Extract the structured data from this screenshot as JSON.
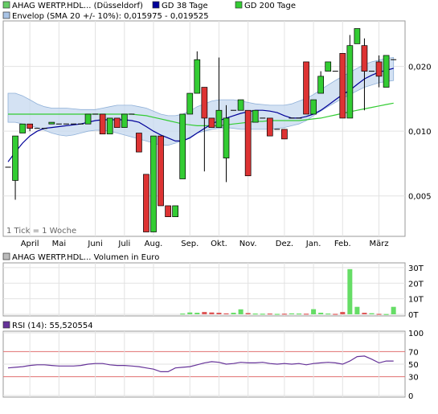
{
  "main_panel": {
    "legend": [
      {
        "label": "AHAG WERTP.HDL... (Düsseldorf)",
        "color": "#66cc66"
      },
      {
        "label": "GD 38 Tage",
        "color": "#000099"
      },
      {
        "label": "GD 200 Tage",
        "color": "#33cc33"
      },
      {
        "label": "Envelop (SMA 20 +/- 10%): 0,015975 - 0,019525",
        "color": "#a9c4e6"
      }
    ],
    "note": "1 Tick = 1 Woche",
    "y_ticks": [
      {
        "v": 0.005,
        "label": "0,005"
      },
      {
        "v": 0.01,
        "label": "0,010"
      },
      {
        "v": 0.02,
        "label": "0,020"
      }
    ],
    "months": [
      {
        "i": 3,
        "label": "April"
      },
      {
        "i": 7,
        "label": "Mai"
      },
      {
        "i": 12,
        "label": "Juni"
      },
      {
        "i": 16,
        "label": "Juli"
      },
      {
        "i": 20,
        "label": "Aug."
      },
      {
        "i": 25,
        "label": "Sep."
      },
      {
        "i": 29,
        "label": "Okt."
      },
      {
        "i": 33,
        "label": "Nov."
      },
      {
        "i": 38,
        "label": "Dez."
      },
      {
        "i": 42,
        "label": "Jan."
      },
      {
        "i": 46,
        "label": "Feb."
      },
      {
        "i": 51,
        "label": "März"
      }
    ]
  },
  "volume_panel": {
    "legend": {
      "label": "AHAG WERTP.HDL... Volumen in Euro",
      "color": "#bbbbbb"
    },
    "y_ticks": [
      {
        "v": 0,
        "label": "0T"
      },
      {
        "v": 10,
        "label": "10T"
      },
      {
        "v": 20,
        "label": "20T"
      },
      {
        "v": 30,
        "label": "30T"
      }
    ]
  },
  "rsi_panel": {
    "legend": {
      "label": "RSI (14): 55,520554",
      "color": "#663399"
    },
    "y_ticks": [
      {
        "v": 0,
        "label": "0"
      },
      {
        "v": 30,
        "label": "30"
      },
      {
        "v": 50,
        "label": "50"
      },
      {
        "v": 70,
        "label": "70"
      },
      {
        "v": 100,
        "label": "100"
      }
    ],
    "ref_lines": [
      30,
      70
    ]
  },
  "chart_data": [
    {
      "type": "candlestick",
      "scale": "log",
      "ylim": [
        0.0033,
        0.032
      ],
      "legend_placement": "top-left",
      "x": "weekly ticks, Mar–Mar (54 weeks)",
      "candles": [
        [
          0.0068,
          0.0068,
          0.0068,
          0.0068
        ],
        [
          0.0059,
          0.0095,
          0.0048,
          0.0095
        ],
        [
          0.0098,
          0.0108,
          0.0098,
          0.0108
        ],
        [
          0.0108,
          0.0108,
          0.01,
          0.0103
        ],
        [
          0.0103,
          0.0103,
          0.0103,
          0.0103
        ],
        [
          0.0103,
          0.0103,
          0.0103,
          0.0103
        ],
        [
          0.0108,
          0.011,
          0.0108,
          0.011
        ],
        [
          0.0108,
          0.0108,
          0.0108,
          0.0108
        ],
        [
          0.0108,
          0.0108,
          0.0108,
          0.0108
        ],
        [
          0.0108,
          0.0108,
          0.0108,
          0.0108
        ],
        [
          0.0108,
          0.0108,
          0.0108,
          0.0108
        ],
        [
          0.0108,
          0.012,
          0.0108,
          0.012
        ],
        [
          0.012,
          0.012,
          0.012,
          0.012
        ],
        [
          0.012,
          0.012,
          0.0097,
          0.0097
        ],
        [
          0.0097,
          0.0115,
          0.0097,
          0.0115
        ],
        [
          0.0115,
          0.0115,
          0.0104,
          0.0104
        ],
        [
          0.0104,
          0.012,
          0.0104,
          0.012
        ],
        [
          0.012,
          0.012,
          0.012,
          0.012
        ],
        [
          0.0098,
          0.0098,
          0.008,
          0.008
        ],
        [
          0.0063,
          0.0063,
          0.0034,
          0.0034
        ],
        [
          0.0034,
          0.0095,
          0.0034,
          0.0095
        ],
        [
          0.0095,
          0.0095,
          0.0045,
          0.0045
        ],
        [
          0.0045,
          0.0045,
          0.004,
          0.004
        ],
        [
          0.004,
          0.0045,
          0.004,
          0.0045
        ],
        [
          0.006,
          0.012,
          0.006,
          0.012
        ],
        [
          0.012,
          0.015,
          0.012,
          0.015
        ],
        [
          0.015,
          0.0235,
          0.015,
          0.0215
        ],
        [
          0.016,
          0.016,
          0.0065,
          0.0115
        ],
        [
          0.0115,
          0.0115,
          0.0104,
          0.0104
        ],
        [
          0.0104,
          0.022,
          0.0104,
          0.0125
        ],
        [
          0.0075,
          0.0132,
          0.0058,
          0.0115
        ],
        [
          0.0125,
          0.0125,
          0.0125,
          0.0125
        ],
        [
          0.0125,
          0.014,
          0.0125,
          0.014
        ],
        [
          0.0125,
          0.0125,
          0.0062,
          0.0062
        ],
        [
          0.011,
          0.0125,
          0.011,
          0.0125
        ],
        [
          0.0115,
          0.0115,
          0.0115,
          0.0115
        ],
        [
          0.0115,
          0.0115,
          0.0095,
          0.0095
        ],
        [
          0.0102,
          0.0102,
          0.0102,
          0.0102
        ],
        [
          0.0102,
          0.0102,
          0.0092,
          0.0092
        ],
        [
          0.0115,
          0.0115,
          0.0115,
          0.0115
        ],
        [
          0.0115,
          0.0115,
          0.0115,
          0.0115
        ],
        [
          0.021,
          0.021,
          0.012,
          0.012
        ],
        [
          0.012,
          0.014,
          0.012,
          0.014
        ],
        [
          0.015,
          0.019,
          0.015,
          0.018
        ],
        [
          0.019,
          0.021,
          0.019,
          0.021
        ],
        [
          0.019,
          0.019,
          0.019,
          0.019
        ],
        [
          0.023,
          0.023,
          0.0115,
          0.0115
        ],
        [
          0.0115,
          0.028,
          0.0115,
          0.025
        ],
        [
          0.0255,
          0.03,
          0.0255,
          0.03
        ],
        [
          0.025,
          0.027,
          0.0125,
          0.019
        ],
        [
          0.019,
          0.019,
          0.019,
          0.019
        ],
        [
          0.021,
          0.0225,
          0.016,
          0.018
        ],
        [
          0.016,
          0.0225,
          0.016,
          0.0225
        ],
        [
          0.0215,
          0.0215,
          0.0215,
          0.0215
        ]
      ],
      "gd38": [
        0.0072,
        0.008,
        0.0088,
        0.0095,
        0.01,
        0.0103,
        0.0104,
        0.0105,
        0.0106,
        0.0107,
        0.0108,
        0.011,
        0.0112,
        0.0113,
        0.0113,
        0.0113,
        0.0113,
        0.0112,
        0.011,
        0.0105,
        0.01,
        0.0096,
        0.0093,
        0.009,
        0.009,
        0.0093,
        0.0098,
        0.0103,
        0.0108,
        0.0112,
        0.0115,
        0.0118,
        0.0121,
        0.0123,
        0.0125,
        0.0125,
        0.0124,
        0.0122,
        0.0118,
        0.0115,
        0.0115,
        0.0117,
        0.012,
        0.0125,
        0.0132,
        0.014,
        0.0148,
        0.0155,
        0.0165,
        0.0175,
        0.0182,
        0.0188,
        0.0192,
        0.0196
      ],
      "gd200": [
        0.012,
        0.012,
        0.012,
        0.012,
        0.012,
        0.012,
        0.012,
        0.012,
        0.012,
        0.012,
        0.012,
        0.012,
        0.012,
        0.012,
        0.012,
        0.012,
        0.012,
        0.012,
        0.0119,
        0.0118,
        0.0116,
        0.0114,
        0.0112,
        0.011,
        0.0108,
        0.0107,
        0.0106,
        0.0106,
        0.0106,
        0.0106,
        0.0107,
        0.0108,
        0.0109,
        0.011,
        0.0111,
        0.0111,
        0.0112,
        0.0112,
        0.0112,
        0.0112,
        0.0112,
        0.0113,
        0.0114,
        0.0115,
        0.0117,
        0.0119,
        0.0121,
        0.0123,
        0.0125,
        0.0127,
        0.0129,
        0.0131,
        0.0133,
        0.0135
      ],
      "envelope_upper": [
        0.015,
        0.015,
        0.0146,
        0.014,
        0.0134,
        0.013,
        0.0128,
        0.0128,
        0.0128,
        0.0127,
        0.0126,
        0.0126,
        0.0126,
        0.0128,
        0.013,
        0.0132,
        0.0132,
        0.0132,
        0.013,
        0.0128,
        0.0124,
        0.012,
        0.0118,
        0.0118,
        0.012,
        0.0124,
        0.013,
        0.0134,
        0.0138,
        0.014,
        0.014,
        0.014,
        0.0138,
        0.0136,
        0.0134,
        0.0133,
        0.0132,
        0.0132,
        0.0132,
        0.0134,
        0.0138,
        0.0142,
        0.0148,
        0.0156,
        0.0164,
        0.0172,
        0.018,
        0.0188,
        0.0196,
        0.0204,
        0.021,
        0.0214,
        0.0218,
        0.022
      ],
      "envelope_lower": [
        0.011,
        0.011,
        0.0108,
        0.0106,
        0.0104,
        0.0101,
        0.0098,
        0.0096,
        0.0095,
        0.0096,
        0.0098,
        0.01,
        0.0101,
        0.0101,
        0.01,
        0.0098,
        0.0096,
        0.0094,
        0.0092,
        0.009,
        0.0088,
        0.0086,
        0.0086,
        0.0088,
        0.009,
        0.0094,
        0.0098,
        0.01,
        0.0102,
        0.0103,
        0.0104,
        0.0103,
        0.0102,
        0.0102,
        0.0102,
        0.0102,
        0.0102,
        0.0103,
        0.0104,
        0.0106,
        0.0108,
        0.0112,
        0.0118,
        0.0124,
        0.013,
        0.0136,
        0.0142,
        0.0148,
        0.0154,
        0.016,
        0.0164,
        0.0168,
        0.017,
        0.0172
      ]
    },
    {
      "type": "bar",
      "title": "AHAG WERTP.HDL... Volumen in Euro",
      "ylim": [
        0,
        32
      ],
      "values": [
        0,
        0,
        0,
        0,
        0,
        0,
        0,
        0,
        0,
        0,
        0,
        0,
        0,
        0,
        0,
        0,
        0,
        0,
        0,
        0,
        0,
        0,
        0,
        0,
        0.5,
        1.2,
        1,
        1.5,
        1.2,
        1,
        0.6,
        1,
        3.2,
        0.8,
        0.5,
        0.4,
        0.5,
        0.3,
        0.4,
        0.6,
        0.5,
        0.4,
        3.3,
        1,
        0.5,
        0.3,
        1.5,
        29,
        4.8,
        1,
        0.7,
        0.3,
        0.2,
        4.8
      ],
      "up": [
        1,
        1,
        1,
        1,
        1,
        1,
        1,
        1,
        1,
        1,
        1,
        1,
        1,
        1,
        1,
        1,
        1,
        1,
        1,
        1,
        1,
        1,
        1,
        1,
        1,
        1,
        1,
        0,
        0,
        0,
        0,
        1,
        1,
        0,
        1,
        1,
        0,
        1,
        0,
        1,
        1,
        0,
        1,
        1,
        1,
        0,
        0,
        1,
        1,
        0,
        1,
        0,
        1,
        1
      ]
    },
    {
      "type": "line",
      "title": "RSI (14): 55,520554",
      "ylim": [
        0,
        100
      ],
      "values": [
        44,
        45,
        46,
        48,
        49,
        49,
        48,
        47,
        47,
        47,
        48,
        50,
        51,
        51,
        49,
        48,
        48,
        47,
        46,
        44,
        42,
        38,
        38,
        44,
        45,
        46,
        49,
        52,
        54,
        53,
        50,
        51,
        53,
        52,
        52,
        53,
        51,
        50,
        51,
        50,
        51,
        49,
        51,
        52,
        53,
        52,
        50,
        55,
        62,
        63,
        58,
        52,
        55,
        55
      ]
    }
  ]
}
